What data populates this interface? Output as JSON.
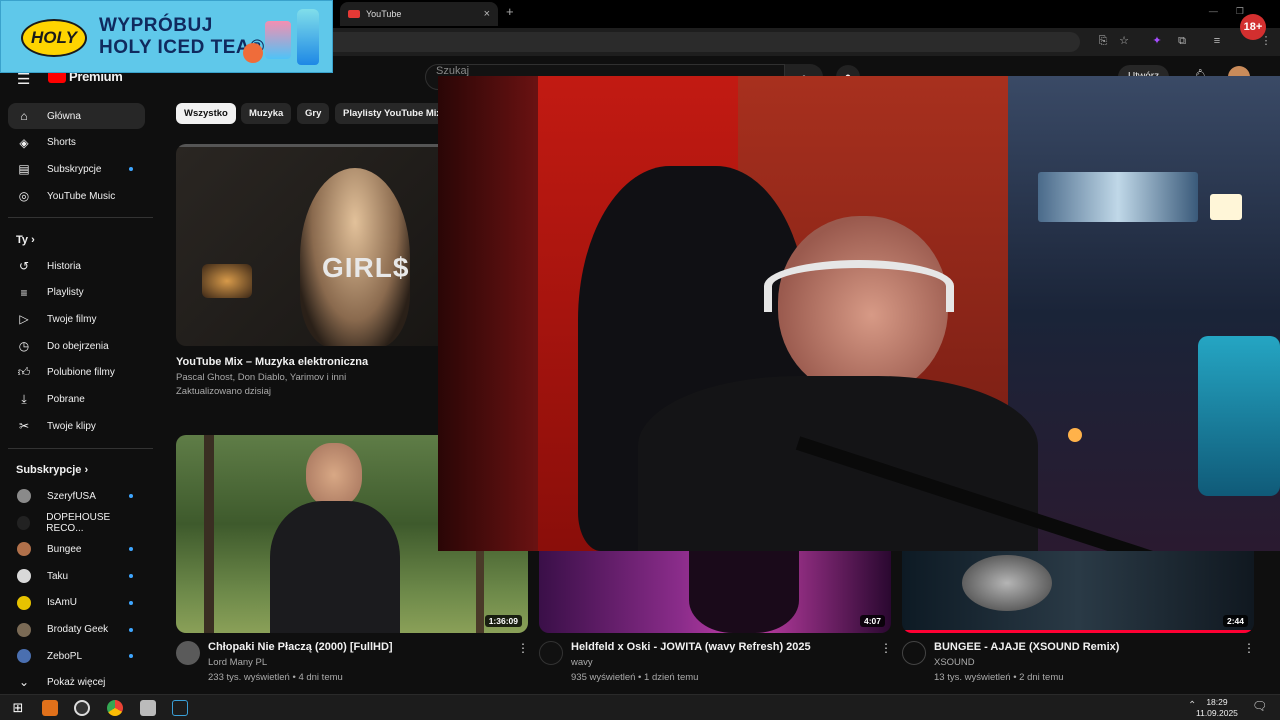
{
  "browser": {
    "tab_title": "YouTube",
    "tab_close": "×",
    "new_tab": "+",
    "age_badge": "18+"
  },
  "ad": {
    "logo": "HOLY",
    "line1": "WYPRÓBUJ",
    "line2": "HOLY ICED TEA®"
  },
  "masthead": {
    "logo_text": "Premium",
    "search_placeholder": "Szukaj",
    "create_label": "Utwórz"
  },
  "sidebar": {
    "main": [
      {
        "label": "Główna",
        "icon": "home-icon",
        "active": true
      },
      {
        "label": "Shorts",
        "icon": "shorts-icon"
      },
      {
        "label": "Subskrypcje",
        "icon": "subscriptions-icon",
        "dot": true
      },
      {
        "label": "YouTube Music",
        "icon": "music-icon"
      }
    ],
    "you_header": "Ty",
    "you": [
      {
        "label": "Historia",
        "icon": "history-icon"
      },
      {
        "label": "Playlisty",
        "icon": "playlists-icon"
      },
      {
        "label": "Twoje filmy",
        "icon": "your-videos-icon"
      },
      {
        "label": "Do obejrzenia",
        "icon": "watch-later-icon"
      },
      {
        "label": "Polubione filmy",
        "icon": "liked-icon"
      },
      {
        "label": "Pobrane",
        "icon": "download-icon"
      },
      {
        "label": "Twoje klipy",
        "icon": "clips-icon"
      }
    ],
    "subs_header": "Subskrypcje",
    "subs": [
      {
        "label": "SzeryfUSA",
        "color": "#8a8a8a",
        "dot": true
      },
      {
        "label": "DOPEHOUSE RECO...",
        "color": "#222222"
      },
      {
        "label": "Bungee",
        "color": "#b0704a",
        "dot": true
      },
      {
        "label": "Taku",
        "color": "#d8d8d8",
        "dot": true
      },
      {
        "label": "IsAmU",
        "color": "#e6c200",
        "dot": true
      },
      {
        "label": "Brodaty Geek",
        "color": "#7a6a55",
        "dot": true
      },
      {
        "label": "ZeboPL",
        "color": "#4a6fb0",
        "dot": true
      }
    ],
    "show_more": "Pokaż więcej"
  },
  "chips": [
    "Wszystko",
    "Muzyka",
    "Gry",
    "Playlisty YouTube Mix"
  ],
  "videos": {
    "mix": {
      "thumb_text": "GIRL$",
      "title": "YouTube Mix – Muzyka elektroniczna",
      "artists": "Pascal Ghost, Don Diablo, Yarimov i inni",
      "updated": "Zaktualizowano dzisiaj"
    },
    "row2": [
      {
        "title": "Chłopaki Nie Płaczą (2000) [FullHD]",
        "channel": "Lord Many PL",
        "stats": "233 tys. wyświetleń • 4 dni temu",
        "duration": "1:36:09"
      },
      {
        "title": "Heldfeld x Oski - JOWITA (wavy Refresh) 2025",
        "channel": "wavy",
        "stats": "935 wyświetleń • 1 dzień temu",
        "duration": "4:07"
      },
      {
        "title": "BUNGEE - AJAJE (XSOUND Remix)",
        "channel": "XSOUND",
        "stats": "13 tys. wyświetleń • 2 dni temu",
        "duration": "2:44"
      }
    ]
  },
  "taskbar": {
    "time": "18:29",
    "date": "11.09.2025"
  }
}
